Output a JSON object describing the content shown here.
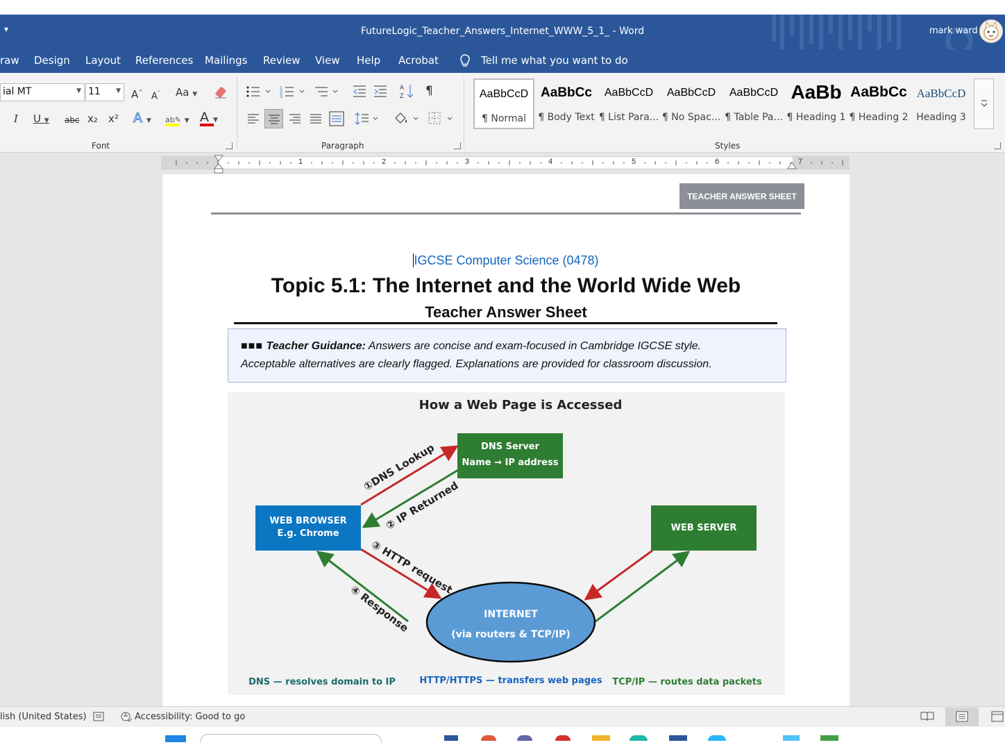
{
  "window": {
    "doc_title": "FutureLogic_Teacher_Answers_Internet_WWW_5_1_  -  Word",
    "user_name": "mark ward",
    "quick_access": "▾"
  },
  "tabs": [
    "raw",
    "Design",
    "Layout",
    "References",
    "Mailings",
    "Review",
    "View",
    "Help",
    "Acrobat"
  ],
  "tell_me": "Tell me what you want to do",
  "font_group": {
    "font_name": "ial MT",
    "font_size": "11",
    "label": "Font",
    "change_case": "Aa",
    "underline_label": "U",
    "italic_label": "I",
    "strike_label": "abc",
    "subscript_label": "x₂",
    "superscript_label": "x²",
    "text_effects_label": "A",
    "font_color_label": "A",
    "grow_label": "A",
    "shrink_label": "A",
    "highlight_color": "#ffff00",
    "font_color": "#e00000"
  },
  "paragraph_group": {
    "label": "Paragraph",
    "show_marks": "¶"
  },
  "styles_group": {
    "label": "Styles",
    "items": [
      {
        "preview": "AaBbCcD",
        "name": "¶ Normal"
      },
      {
        "preview": "AaBbCc",
        "name": "¶ Body Text"
      },
      {
        "preview": "AaBbCcD",
        "name": "¶ List Para..."
      },
      {
        "preview": "AaBbCcD",
        "name": "¶ No Spac..."
      },
      {
        "preview": "AaBbCcD",
        "name": "¶ Table Pa..."
      },
      {
        "preview": "AaBb",
        "name": "¶ Heading 1"
      },
      {
        "preview": "AaBbCc",
        "name": "¶ Heading 2"
      },
      {
        "preview": "AaBbCcD",
        "name": "Heading 3"
      }
    ]
  },
  "ruler": {
    "numbers": [
      "1",
      "2",
      "3",
      "4",
      "5",
      "6",
      "7"
    ]
  },
  "document": {
    "badge": "TEACHER ANSWER SHEET",
    "course": "IGCSE Computer Science (0478)",
    "title": "Topic 5.1: The Internet and the World Wide Web",
    "subtitle": "Teacher Answer Sheet",
    "guidance_marks": "■■■",
    "guidance_label": "Teacher Guidance:",
    "guidance_text": "Answers are concise and exam-focused in Cambridge IGCSE style.",
    "guidance_text2": "Acceptable alternatives are clearly flagged. Explanations are provided for classroom discussion."
  },
  "diagram": {
    "title": "How a Web Page is Accessed",
    "dns_server_line1": "DNS Server",
    "dns_server_line2": "Name → IP address",
    "web_browser_line1": "WEB BROWSER",
    "web_browser_line2": "E.g. Chrome",
    "web_server": "WEB SERVER",
    "internet_line1": "INTERNET",
    "internet_line2": "(via routers & TCP/IP)",
    "step1": "①DNS Lookup",
    "step2": "② IP Returned",
    "step3": "③ HTTP request",
    "step4": "④ Response",
    "legend_dns": "DNS — resolves domain to IP",
    "legend_http": "HTTP/HTTPS — transfers web pages",
    "legend_tcp": "TCP/IP — routes data packets",
    "colors": {
      "green": "#2e7d32",
      "red": "#c62828",
      "blue": "#0b76c2",
      "ellipse": "#5b9bd5"
    }
  },
  "status": {
    "language": "lish (United States)",
    "accessibility": "Accessibility: Good to go"
  }
}
